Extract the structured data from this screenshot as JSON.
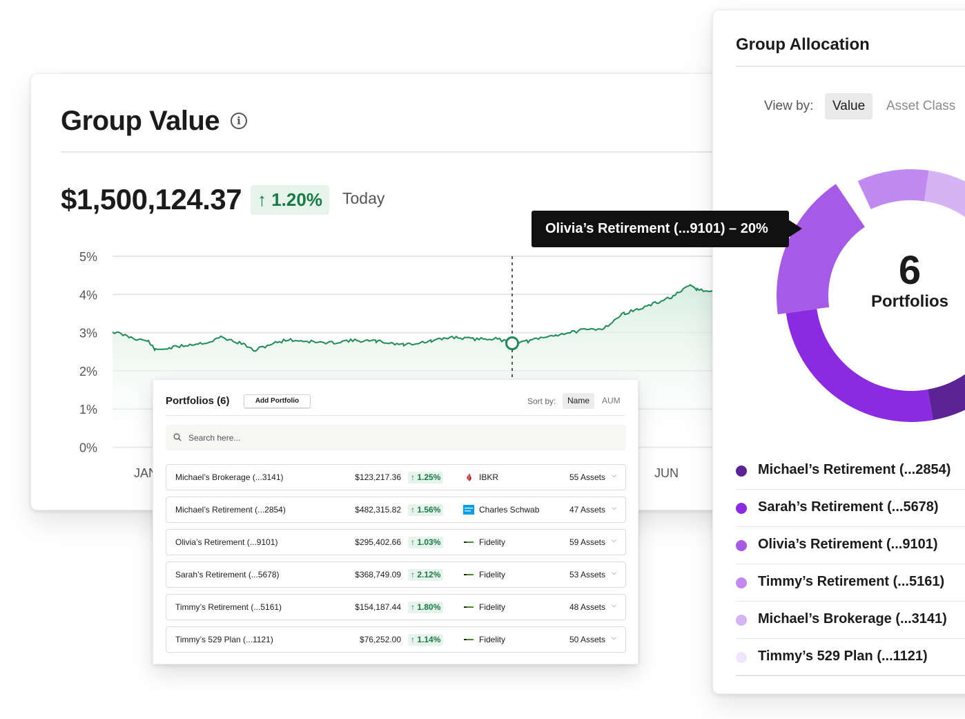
{
  "group_value": {
    "title": "Group Value",
    "info_icon_glyph": "i",
    "amount": "$1,500,124.37",
    "change": "↑ 1.20%",
    "period": "Today",
    "chart": {
      "y_ticks": [
        "5%",
        "4%",
        "3%",
        "2%",
        "1%",
        "0%"
      ],
      "x_ticks": [
        "JAN",
        "JUN"
      ],
      "line_color": "#1f8a55",
      "fill_color": "#dff0e6"
    }
  },
  "tooltip": {
    "text": "Olivia’s Retirement (...9101) – 20%"
  },
  "group_allocation": {
    "title": "Group Allocation",
    "view_by_label": "View by:",
    "view_options": [
      "Value",
      "Asset Class"
    ],
    "selected_view": "Value",
    "count": "6",
    "count_label": "Portfolios",
    "legend": [
      {
        "label": "Michael’s Retirement (...2854)",
        "color": "#5b2394"
      },
      {
        "label": "Sarah’s Retirement (...5678)",
        "color": "#8a2be2"
      },
      {
        "label": "Olivia’s Retirement (...9101)",
        "color": "#a65ae6"
      },
      {
        "label": "Timmy’s Retirement (...5161)",
        "color": "#c18af0"
      },
      {
        "label": "Michael’s Brokerage (...3141)",
        "color": "#d6b3f4"
      },
      {
        "label": "Timmy’s 529 Plan (...1121)",
        "color": "#efe6fb"
      }
    ]
  },
  "portfolios": {
    "title": "Portfolios (6)",
    "add_button": "Add Portfolio",
    "sort_label": "Sort by:",
    "sort_options": [
      "Name",
      "AUM"
    ],
    "selected_sort": "Name",
    "search_placeholder": "Search here...",
    "rows": [
      {
        "name": "Michael’s Brokerage (...3141)",
        "value": "$123,217.36",
        "change": "↑ 1.25%",
        "custodian": "IBKR",
        "custodian_icon": "ibkr-logo",
        "assets": "55 Assets"
      },
      {
        "name": "Michael’s Retirement (...2854)",
        "value": "$482,315.82",
        "change": "↑ 1.56%",
        "custodian": "Charles Schwab",
        "custodian_icon": "schwab-logo",
        "assets": "47 Assets"
      },
      {
        "name": "Olivia’s Retirement (...9101)",
        "value": "$295,402.66",
        "change": "↑ 1.03%",
        "custodian": "Fidelity",
        "custodian_icon": "fidelity-logo",
        "assets": "59 Assets"
      },
      {
        "name": "Sarah’s Retirement (...5678)",
        "value": "$368,749.09",
        "change": "↑ 2.12%",
        "custodian": "Fidelity",
        "custodian_icon": "fidelity-logo",
        "assets": "53 Assets"
      },
      {
        "name": "Timmy’s Retirement (...5161)",
        "value": "$154,187.44",
        "change": "↑ 1.80%",
        "custodian": "Fidelity",
        "custodian_icon": "fidelity-logo",
        "assets": "48 Assets"
      },
      {
        "name": "Timmy’s 529 Plan (...1121)",
        "value": "$76,252.00",
        "change": "↑ 1.14%",
        "custodian": "Fidelity",
        "custodian_icon": "fidelity-logo",
        "assets": "50 Assets"
      }
    ]
  }
}
